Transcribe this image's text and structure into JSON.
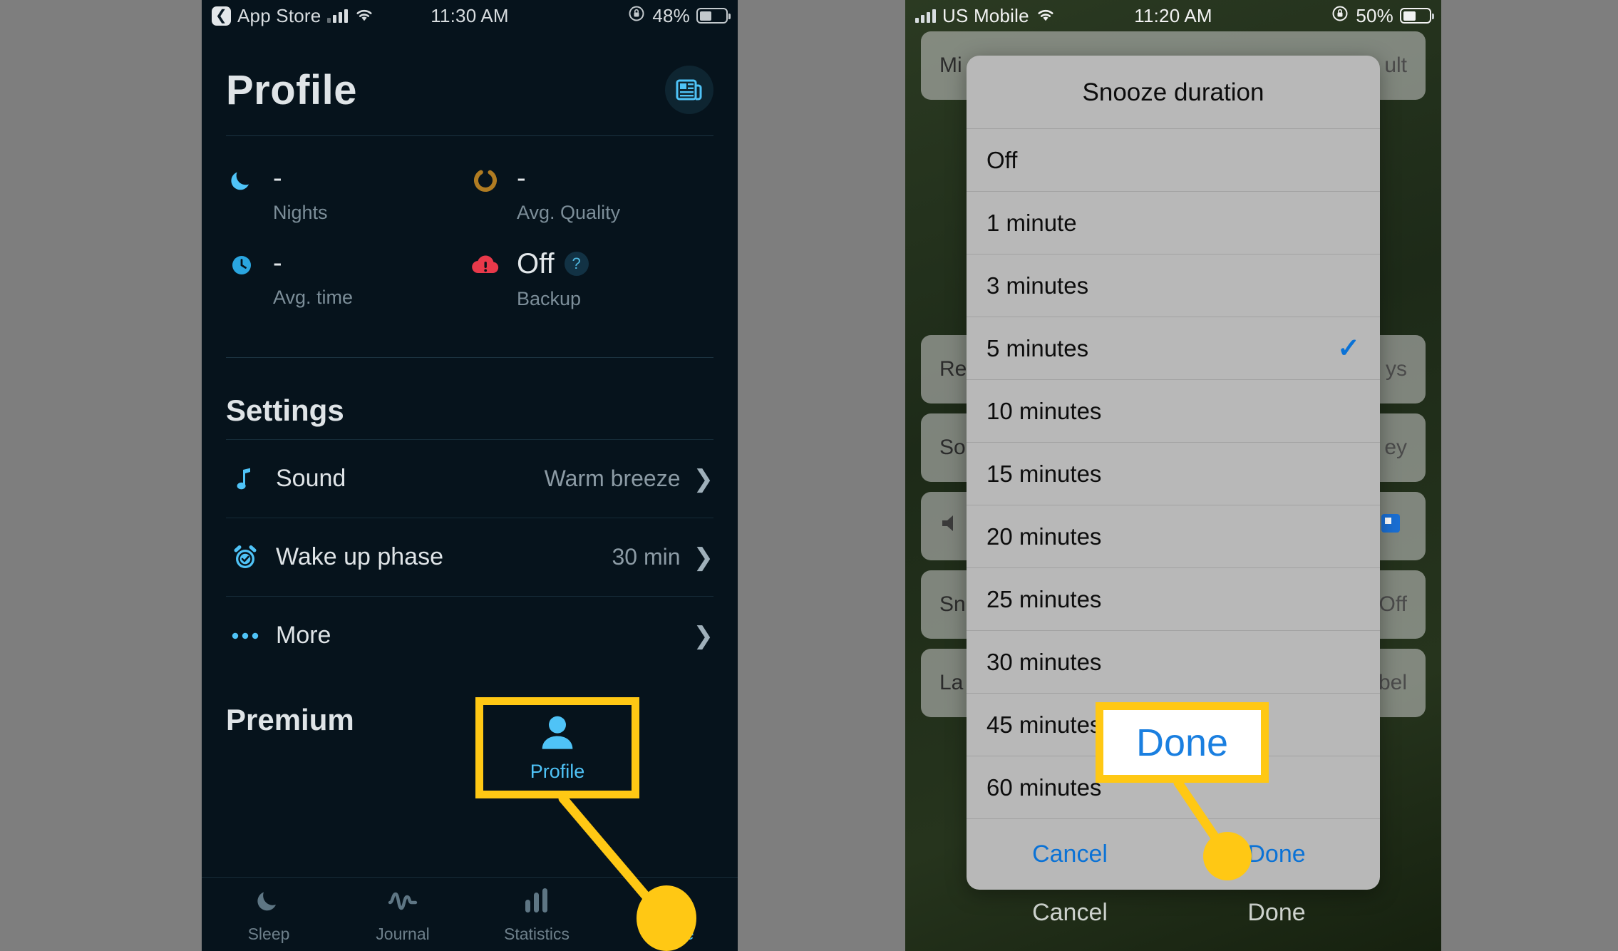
{
  "left_phone": {
    "status_bar": {
      "back_label": "App Store",
      "back_icon": "chevron-left-icon",
      "signal_icon": "cellular-bars-icon",
      "wifi_icon": "wifi-icon",
      "time": "11:30 AM",
      "orientation_lock_icon": "rotation-lock-icon",
      "battery_percent": "48%",
      "battery_icon": "battery-icon",
      "battery_level": 48
    },
    "header": {
      "title": "Profile",
      "news_button_icon": "newspaper-icon"
    },
    "stats": [
      {
        "icon": "moon-icon",
        "value": "-",
        "label": "Nights",
        "icon_color": "#4fc3f7"
      },
      {
        "icon": "ring-icon",
        "value": "-",
        "label": "Avg. Quality",
        "icon_color": "#b07c22"
      },
      {
        "icon": "clock-icon",
        "value": "-",
        "label": "Avg. time",
        "icon_color": "#2aa6e0"
      },
      {
        "icon": "cloud-alert-icon",
        "value": "Off",
        "label": "Backup",
        "icon_color": "#e8394a",
        "help_icon": "question-mark-icon"
      }
    ],
    "settings": {
      "section_title": "Settings",
      "rows": [
        {
          "icon": "music-note-icon",
          "label": "Sound",
          "value": "Warm breeze",
          "chevron": "chevron-right-icon"
        },
        {
          "icon": "alarm-clock-icon",
          "label": "Wake up phase",
          "value": "30 min",
          "chevron": "chevron-right-icon"
        },
        {
          "icon": "ellipsis-icon",
          "label": "More",
          "value": "",
          "chevron": "chevron-right-icon"
        }
      ]
    },
    "premium_title": "Premium",
    "tabbar": [
      {
        "icon": "moon-icon",
        "label": "Sleep",
        "active": false
      },
      {
        "icon": "waveform-icon",
        "label": "Journal",
        "active": false
      },
      {
        "icon": "bar-chart-icon",
        "label": "Statistics",
        "active": false
      },
      {
        "icon": "person-icon",
        "label": "Profile",
        "active": true
      }
    ]
  },
  "right_phone": {
    "status_bar": {
      "signal_icon": "cellular-bars-icon",
      "carrier": "US Mobile",
      "wifi_icon": "wifi-icon",
      "time": "11:20 AM",
      "orientation_lock_icon": "rotation-lock-icon",
      "battery_percent": "50%",
      "battery_icon": "battery-icon",
      "battery_level": 50
    },
    "background_rows": [
      {
        "label": "Mi",
        "value": "ult"
      },
      {
        "label": "Re",
        "value": "ys"
      },
      {
        "label": "So",
        "value": "ey"
      },
      {
        "label": "",
        "value": ""
      },
      {
        "label": "Sn",
        "value": "Off"
      },
      {
        "label": "La",
        "value": "bel"
      }
    ],
    "dialog": {
      "title": "Snooze duration",
      "options": [
        {
          "label": "Off",
          "selected": false
        },
        {
          "label": "1 minute",
          "selected": false
        },
        {
          "label": "3 minutes",
          "selected": false
        },
        {
          "label": "5 minutes",
          "selected": true
        },
        {
          "label": "10 minutes",
          "selected": false
        },
        {
          "label": "15 minutes",
          "selected": false
        },
        {
          "label": "20 minutes",
          "selected": false
        },
        {
          "label": "25 minutes",
          "selected": false
        },
        {
          "label": "30 minutes",
          "selected": false
        },
        {
          "label": "45 minutes",
          "selected": false
        },
        {
          "label": "60 minutes",
          "selected": false
        }
      ],
      "checkmark_icon": "checkmark-icon",
      "cancel_label": "Cancel",
      "done_label": "Done"
    },
    "ghost_actions": {
      "cancel_label": "Cancel",
      "done_label": "Done"
    }
  },
  "callouts": {
    "profile": {
      "label": "Profile",
      "icon": "person-icon"
    },
    "done": {
      "label": "Done"
    }
  },
  "colors": {
    "highlight": "#FFC814",
    "accent_blue": "#4fc3f7",
    "link_blue": "#0a72d6",
    "app_bg": "#06131c",
    "page_bg": "#7e7e7e"
  }
}
